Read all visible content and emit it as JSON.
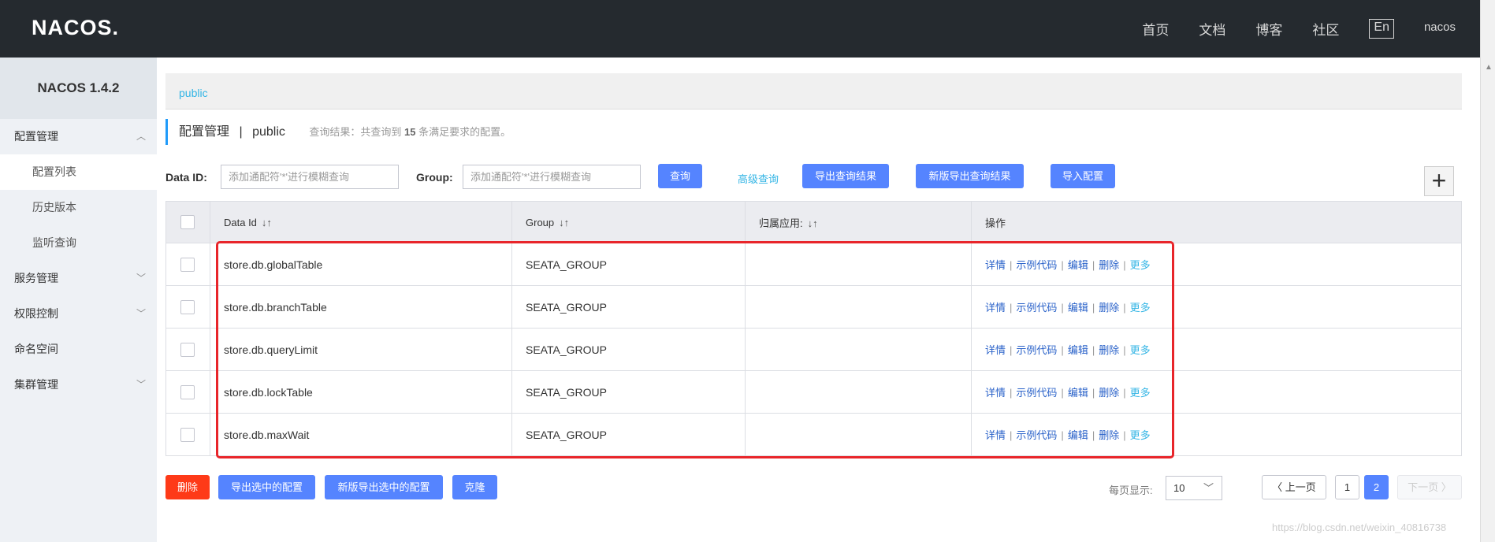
{
  "header": {
    "logo": "NACOS.",
    "nav": [
      "首页",
      "文档",
      "博客",
      "社区"
    ],
    "lang": "En",
    "user": "nacos"
  },
  "sidebar": {
    "version": "NACOS 1.4.2",
    "items": [
      {
        "label": "配置管理",
        "type": "group",
        "chevron": "up"
      },
      {
        "label": "配置列表",
        "type": "sub",
        "active": true
      },
      {
        "label": "历史版本",
        "type": "sub"
      },
      {
        "label": "监听查询",
        "type": "sub"
      },
      {
        "label": "服务管理",
        "type": "group",
        "chevron": "down"
      },
      {
        "label": "权限控制",
        "type": "group",
        "chevron": "down"
      },
      {
        "label": "命名空间",
        "type": "group"
      },
      {
        "label": "集群管理",
        "type": "group",
        "chevron": "down"
      }
    ]
  },
  "namespace": "public",
  "title": {
    "main": "配置管理",
    "sep": "|",
    "ns": "public",
    "info_prefix": "查询结果：共查询到",
    "count": "15",
    "info_suffix": "条满足要求的配置。"
  },
  "search": {
    "dataid_label": "Data ID:",
    "dataid_placeholder": "添加通配符'*'进行模糊查询",
    "group_label": "Group:",
    "group_placeholder": "添加通配符'*'进行模糊查询",
    "query": "查询",
    "advanced": "高级查询",
    "export": "导出查询结果",
    "export_new": "新版导出查询结果",
    "import": "导入配置",
    "add": "+"
  },
  "table": {
    "headers": [
      "Data Id",
      "Group",
      "归属应用:",
      "操作"
    ],
    "rows": [
      {
        "dataId": "store.db.globalTable",
        "group": "SEATA_GROUP",
        "app": ""
      },
      {
        "dataId": "store.db.branchTable",
        "group": "SEATA_GROUP",
        "app": ""
      },
      {
        "dataId": "store.db.queryLimit",
        "group": "SEATA_GROUP",
        "app": ""
      },
      {
        "dataId": "store.db.lockTable",
        "group": "SEATA_GROUP",
        "app": ""
      },
      {
        "dataId": "store.db.maxWait",
        "group": "SEATA_GROUP",
        "app": ""
      }
    ],
    "ops": [
      "详情",
      "示例代码",
      "编辑",
      "删除",
      "更多"
    ],
    "sort_glyph": "↓↑"
  },
  "bottom": {
    "delete": "删除",
    "export_sel": "导出选中的配置",
    "export_sel_new": "新版导出选中的配置",
    "clone": "克隆",
    "page_size_label": "每页显示:",
    "page_size": "10",
    "prev": "上一页",
    "pages": [
      "1",
      "2"
    ],
    "current_page": "2",
    "next": "下一页"
  },
  "watermark": "https://blog.csdn.net/weixin_40816738",
  "colors": {
    "accent": "#5584ff",
    "danger": "#fe3a18",
    "link": "#33b5e5",
    "highlight": "#e8252a"
  }
}
